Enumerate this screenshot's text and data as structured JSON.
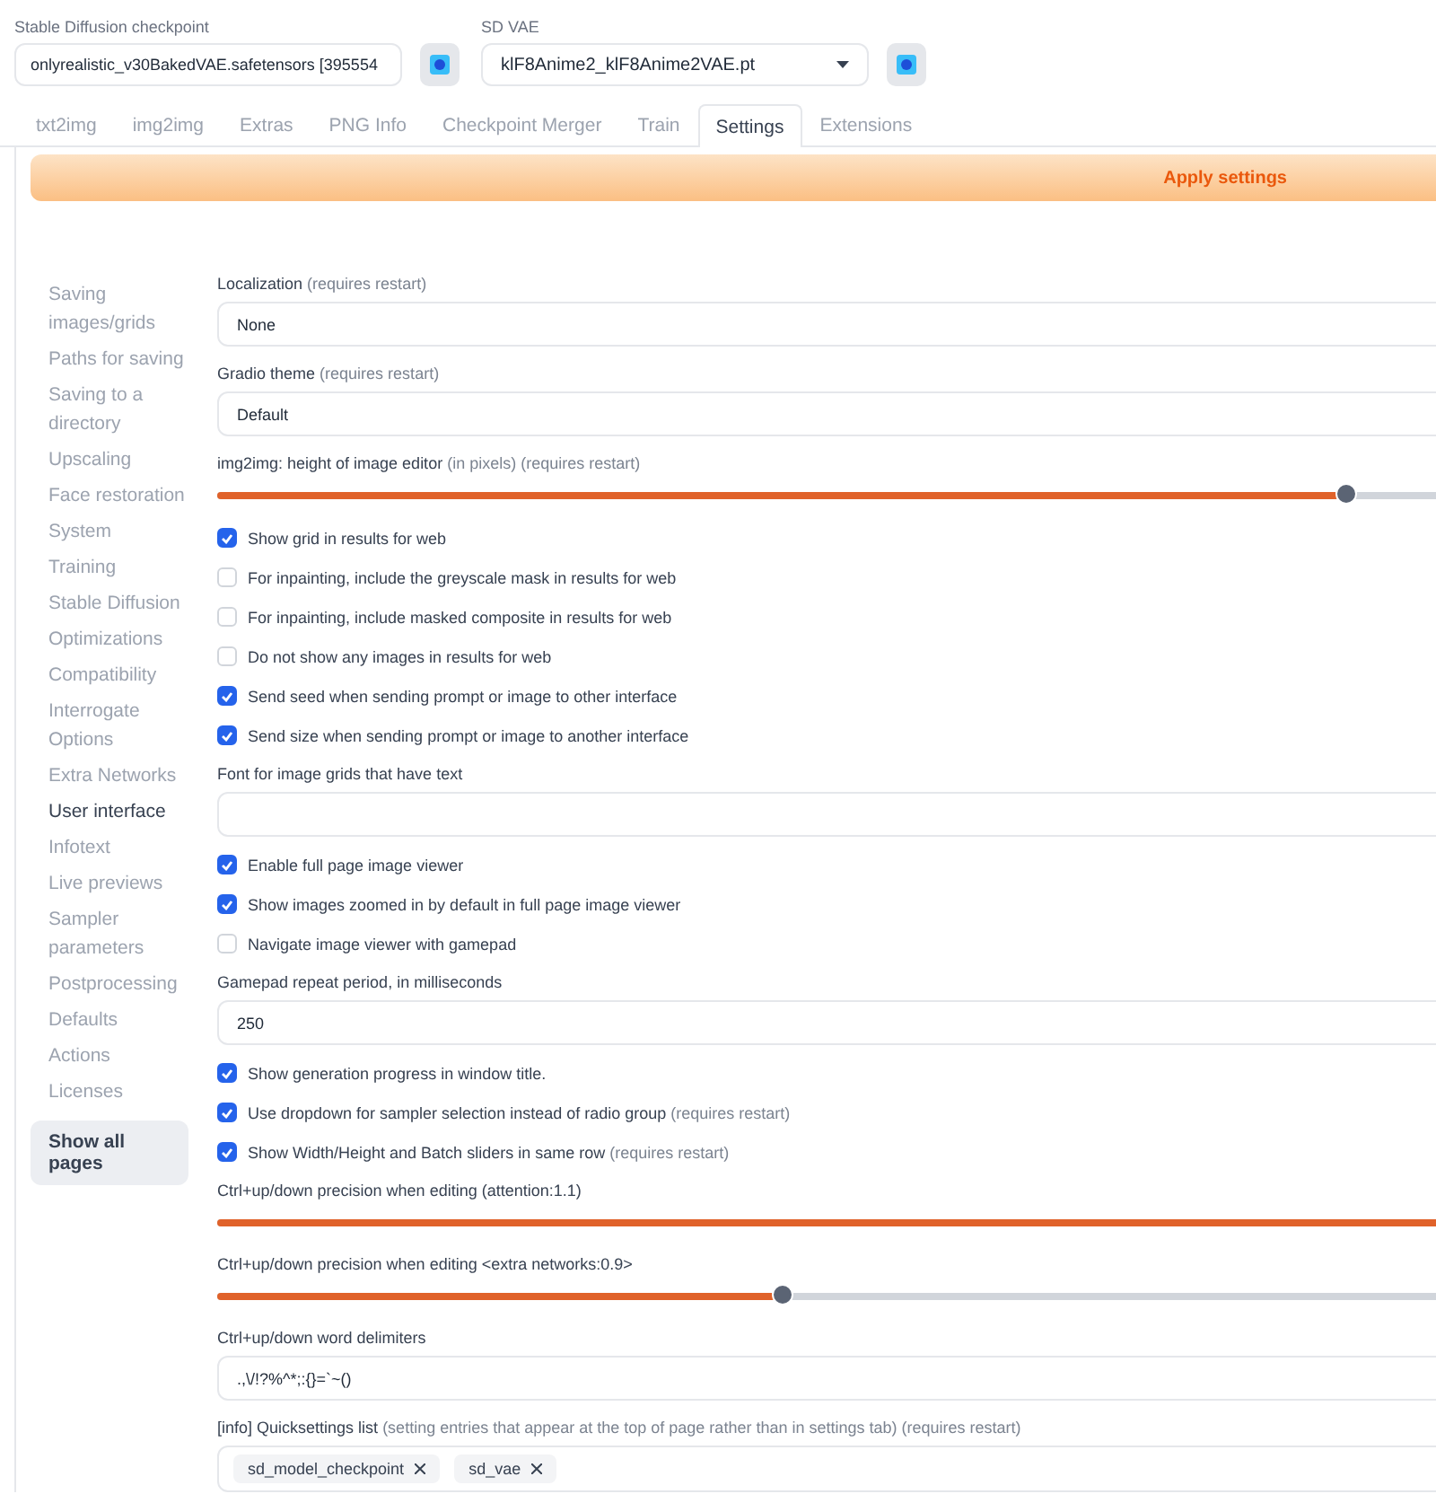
{
  "top_selectors": [
    {
      "label": "Stable Diffusion checkpoint",
      "value": "onlyrealistic_v30BakedVAE.safetensors [395554"
    },
    {
      "label": "SD VAE",
      "value": "klF8Anime2_klF8Anime2VAE.pt"
    }
  ],
  "tabs": [
    {
      "label": "txt2img",
      "selected": false
    },
    {
      "label": "img2img",
      "selected": false
    },
    {
      "label": "Extras",
      "selected": false
    },
    {
      "label": "PNG Info",
      "selected": false
    },
    {
      "label": "Checkpoint Merger",
      "selected": false
    },
    {
      "label": "Train",
      "selected": false
    },
    {
      "label": "Settings",
      "selected": true
    },
    {
      "label": "Extensions",
      "selected": false
    }
  ],
  "apply_button": "Apply settings",
  "sidebar": {
    "items": [
      {
        "label": "Saving images/grids",
        "selected": false
      },
      {
        "label": "Paths for saving",
        "selected": false
      },
      {
        "label": "Saving to a directory",
        "selected": false
      },
      {
        "label": "Upscaling",
        "selected": false
      },
      {
        "label": "Face restoration",
        "selected": false
      },
      {
        "label": "System",
        "selected": false
      },
      {
        "label": "Training",
        "selected": false
      },
      {
        "label": "Stable Diffusion",
        "selected": false
      },
      {
        "label": "Optimizations",
        "selected": false
      },
      {
        "label": "Compatibility",
        "selected": false
      },
      {
        "label": "Interrogate Options",
        "selected": false
      },
      {
        "label": "Extra Networks",
        "selected": false
      },
      {
        "label": "User interface",
        "selected": true
      },
      {
        "label": "Infotext",
        "selected": false
      },
      {
        "label": "Live previews",
        "selected": false
      },
      {
        "label": "Sampler parameters",
        "selected": false
      },
      {
        "label": "Postprocessing",
        "selected": false
      },
      {
        "label": "Defaults",
        "selected": false
      },
      {
        "label": "Actions",
        "selected": false
      },
      {
        "label": "Licenses",
        "selected": false
      }
    ],
    "show_all_button": "Show all pages"
  },
  "settings": [
    {
      "kind": "select",
      "label": "Localization",
      "note": "(requires restart)",
      "value": "None"
    },
    {
      "kind": "select",
      "label": "Gradio theme",
      "note": "(requires restart)",
      "value": "Default"
    },
    {
      "kind": "slider",
      "label": "img2img: height of image editor",
      "note": "(in pixels) (requires restart)",
      "level": 0.9
    },
    {
      "kind": "checkbox",
      "label": "Show grid in results for web",
      "checked": true
    },
    {
      "kind": "checkbox",
      "label": "For inpainting, include the greyscale mask in results for web",
      "checked": false
    },
    {
      "kind": "checkbox",
      "label": "For inpainting, include masked composite in results for web",
      "checked": false
    },
    {
      "kind": "checkbox",
      "label": "Do not show any images in results for web",
      "checked": false
    },
    {
      "kind": "checkbox",
      "label": "Send seed when sending prompt or image to other interface",
      "checked": true
    },
    {
      "kind": "checkbox",
      "label": "Send size when sending prompt or image to another interface",
      "checked": true
    },
    {
      "kind": "text",
      "label": "Font for image grids that have text"
    },
    {
      "kind": "checkbox",
      "label": "Enable full page image viewer",
      "checked": true
    },
    {
      "kind": "checkbox",
      "label": "Show images zoomed in by default in full page image viewer",
      "checked": true
    },
    {
      "kind": "checkbox",
      "label": "Navigate image viewer with gamepad",
      "checked": false
    },
    {
      "kind": "text",
      "label": "Gamepad repeat period, in milliseconds",
      "value": "250"
    },
    {
      "kind": "checkbox",
      "label": "Show generation progress in window title.",
      "checked": true
    },
    {
      "kind": "checkbox",
      "label": "Use dropdown for sampler selection instead of radio group",
      "note": "(requires restart)",
      "checked": true
    },
    {
      "kind": "checkbox",
      "label": "Show Width/Height and Batch sliders in same row",
      "note": "(requires restart)",
      "checked": true
    },
    {
      "kind": "slider",
      "label": "Ctrl+up/down precision when editing (attention:1.1)",
      "level": 1
    },
    {
      "kind": "slider",
      "label": "Ctrl+up/down precision when editing <extra networks:0.9>",
      "level": 0.45
    },
    {
      "kind": "text",
      "label": "Ctrl+up/down word delimiters",
      "value": ".,\\/!?%^*;:{}=`~()"
    },
    {
      "kind": "chips",
      "label": "[info] Quicksettings list",
      "note": "(setting entries that appear at the top of page rather than in settings tab) (requires restart)",
      "chips": [
        "sd_model_checkpoint",
        "sd_vae"
      ]
    }
  ]
}
